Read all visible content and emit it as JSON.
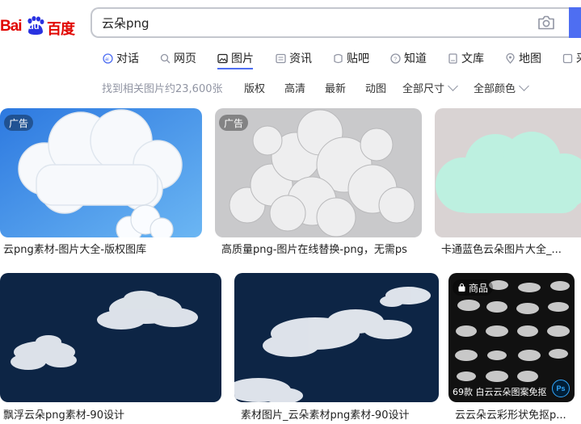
{
  "logo": {
    "bai": "Bai",
    "du": "du",
    "cn": "百度"
  },
  "search": {
    "query": "云朵png",
    "placeholder": ""
  },
  "nav": {
    "items": [
      {
        "label": "对话",
        "icon": "ai-chat-icon"
      },
      {
        "label": "网页",
        "icon": "search-icon"
      },
      {
        "label": "图片",
        "icon": "image-icon",
        "active": true
      },
      {
        "label": "资讯",
        "icon": "news-icon"
      },
      {
        "label": "贴吧",
        "icon": "tieba-icon"
      },
      {
        "label": "知道",
        "icon": "question-icon"
      },
      {
        "label": "文库",
        "icon": "document-icon"
      },
      {
        "label": "地图",
        "icon": "map-pin-icon"
      },
      {
        "label": "采",
        "icon": "purchase-icon"
      }
    ]
  },
  "filters": {
    "result_count": "找到相关图片约23,600张",
    "copyright": "版权",
    "hd": "高清",
    "latest": "最新",
    "animated": "动图",
    "size": "全部尺寸",
    "color": "全部颜色"
  },
  "results": [
    {
      "caption": "云png素材-图片大全-版权图库",
      "badge": "广告"
    },
    {
      "caption": "高质量png-图片在线替换-png，无需ps",
      "badge": "广告"
    },
    {
      "caption": "卡通蓝色云朵图片大全_...",
      "badge": ""
    },
    {
      "caption": "飘浮云朵png素材-90设计",
      "badge": ""
    },
    {
      "caption": "素材图片_云朵素材png素材-90设计",
      "badge": ""
    },
    {
      "caption": "云云朵云彩形状免抠p...",
      "badge": "商品",
      "note": "69款  白云云朵图案免抠",
      "ps": "Ps"
    }
  ],
  "colors": {
    "accent": "#4e6ef2",
    "brand_red": "#e10601"
  }
}
